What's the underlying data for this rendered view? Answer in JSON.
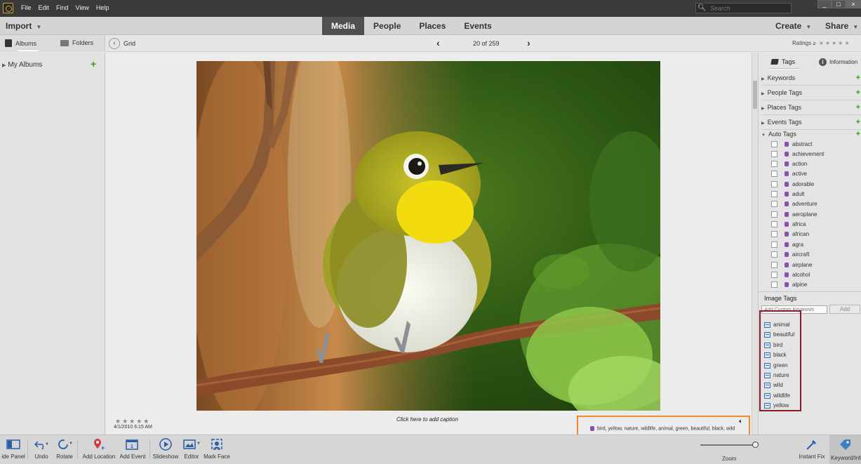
{
  "menubar": {
    "items": [
      "File",
      "Edit",
      "Find",
      "View",
      "Help"
    ],
    "search_placeholder": "Search",
    "window_controls": [
      "_",
      "□",
      "×"
    ]
  },
  "toolbar": {
    "import_label": "Import",
    "tabs": [
      "Media",
      "People",
      "Places",
      "Events"
    ],
    "active_tab": "Media",
    "create_label": "Create",
    "share_label": "Share"
  },
  "subbar": {
    "albums_tab": "Albums",
    "folders_tab": "Folders",
    "grid_label": "Grid",
    "page_counter": "20 of 259",
    "ratings_label": "Ratings ≥",
    "ratings_stars": "★★★★★"
  },
  "left_panel": {
    "my_albums": "My Albums",
    "add_icon": "+"
  },
  "photo": {
    "stars": "★★★★★",
    "datetime": "4/1/2010 6:15 AM",
    "caption_placeholder": "Click here to add caption",
    "tag_line": "bird, yellow, nature, wildlife, animal, green, beautiful, black, wild"
  },
  "right_panel": {
    "tags_tab": "Tags",
    "info_tab": "Information",
    "categories": [
      "Keywords",
      "People Tags",
      "Places Tags",
      "Events Tags",
      "Auto Tags"
    ],
    "auto_tags": [
      "abstract",
      "achievement",
      "action",
      "active",
      "adorable",
      "adult",
      "adventure",
      "aeroplane",
      "africa",
      "african",
      "agra",
      "aircraft",
      "airplane",
      "alcohol",
      "alpine"
    ],
    "image_tags_header": "Image Tags",
    "keyword_placeholder": "Add Custom Keywords",
    "add_button": "Add",
    "image_tags": [
      "animal",
      "beautiful",
      "bird",
      "black",
      "green",
      "nature",
      "wild",
      "wildlife",
      "yellow"
    ]
  },
  "bottombar": {
    "hide_panel": "ide Panel",
    "undo": "Undo",
    "rotate": "Rotate",
    "add_location": "Add Location",
    "add_event": "Add Event",
    "slideshow": "Slideshow",
    "editor": "Editor",
    "mark_face": "Mark Face",
    "zoom": "Zoom",
    "instant_fix": "Instant Fix",
    "keyword_info": "Keyword/Info"
  },
  "colors": {
    "accent_green": "#3a9a1a",
    "tag_strip_border": "#f08a2a",
    "image_tags_border": "#8a1c2a",
    "active_tab_bg": "#505050"
  }
}
